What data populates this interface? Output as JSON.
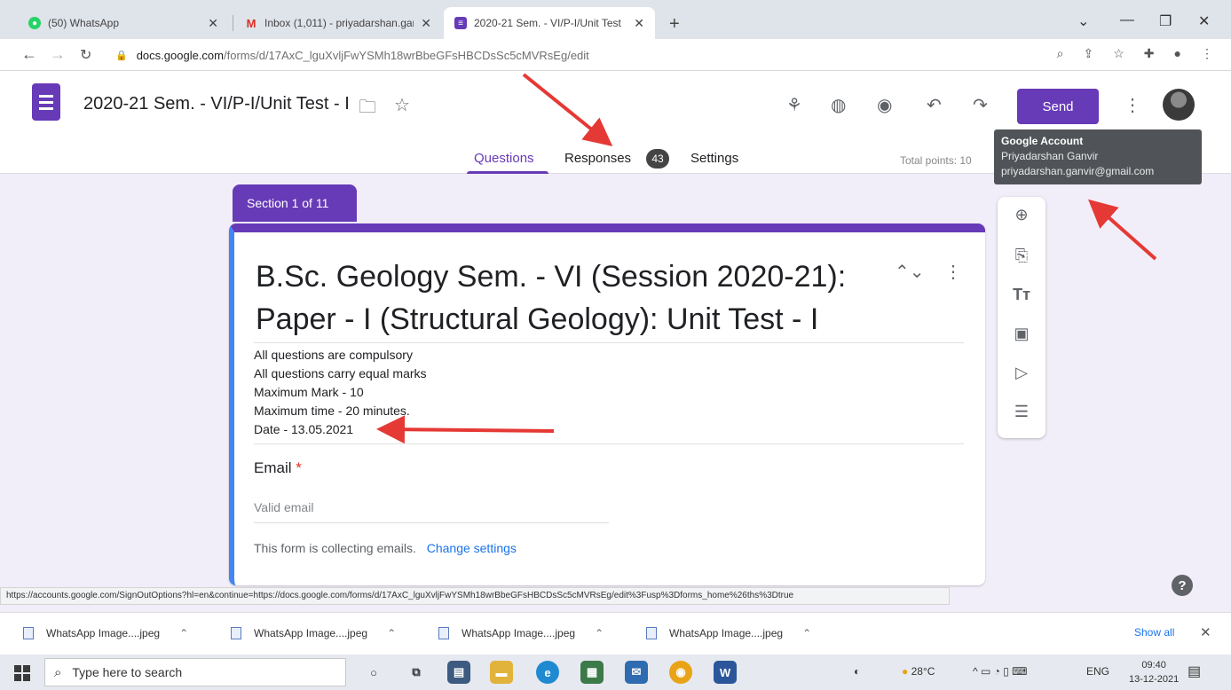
{
  "browser": {
    "tabs": [
      {
        "title": "(50) WhatsApp",
        "icon": "whatsapp-icon",
        "color": "#25d366"
      },
      {
        "title": "Inbox (1,011) - priyadarshan.gan...",
        "icon": "gmail-icon",
        "color": "#d93025"
      },
      {
        "title": "2020-21 Sem. - VI/P-I/Unit Test",
        "icon": "google-forms-icon",
        "color": "#673ab7"
      }
    ],
    "new_tab": "+",
    "url_host": "docs.google.com",
    "url_path": "/forms/d/17AxC_lguXvljFwYSMh18wrBbeGFsHBCDsSc5cMVRsEg/edit"
  },
  "form_header": {
    "doc_title": "2020-21 Sem. - VI/P-I/Unit Test - I",
    "send_label": "Send",
    "tabs": {
      "questions": "Questions",
      "responses": "Responses",
      "responses_count": "43",
      "settings": "Settings"
    },
    "total_points": "Total points: 10"
  },
  "account_tooltip": {
    "title": "Google Account",
    "name": "Priyadarshan Ganvir",
    "email": "priyadarshan.ganvir@gmail.com"
  },
  "section_tag": "Section 1 of 11",
  "form": {
    "title": "B.Sc. Geology Sem. - VI (Session 2020-21): Paper - I (Structural Geology): Unit Test - I",
    "description": [
      "All questions are compulsory",
      "All questions carry equal marks",
      "Maximum Mark - 10",
      "Maximum time - 20 minutes.",
      "Date - 13.05.2021"
    ],
    "email_label": "Email",
    "required_mark": "*",
    "email_placeholder": "Valid email",
    "collecting_text": "This form is collecting emails.",
    "change_settings": "Change settings"
  },
  "status_url": "https://accounts.google.com/SignOutOptions?hl=en&continue=https://docs.google.com/forms/d/17AxC_lguXvljFwYSMh18wrBbeGFsHBCDsSc5cMVRsEg/edit%3Fusp%3Dforms_home%26ths%3Dtrue",
  "downloads": {
    "items": [
      "WhatsApp Image....jpeg",
      "WhatsApp Image....jpeg",
      "WhatsApp Image....jpeg",
      "WhatsApp Image....jpeg"
    ],
    "show_all": "Show all"
  },
  "taskbar": {
    "search_placeholder": "Type here to search",
    "weather": "28°C",
    "lang": "ENG",
    "time": "09:40",
    "date": "13-12-2021"
  },
  "colors": {
    "forms_purple": "#673ab7",
    "accent_blue": "#4285f4",
    "annotation_red": "#e53935"
  }
}
